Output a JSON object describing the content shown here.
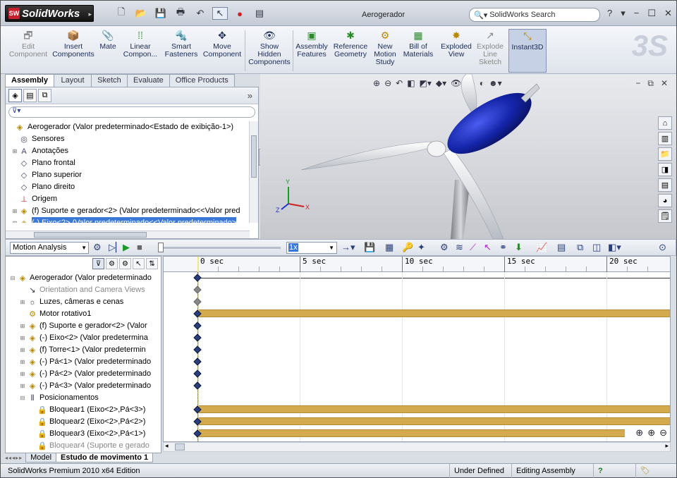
{
  "app": {
    "name": "SolidWorks",
    "doc_title": "Aerogerador",
    "search_placeholder": "SolidWorks Search",
    "help": "?"
  },
  "quick_access": [
    "new-icon",
    "open-icon",
    "save-icon",
    "print-icon",
    "undo-icon",
    "select-icon",
    "rebuild-icon",
    "options-icon"
  ],
  "commands": [
    {
      "id": "edit-component",
      "label": "Edit\nComponent",
      "icon": "🗗",
      "disabled": true
    },
    {
      "id": "insert-components",
      "label": "Insert\nComponents",
      "icon": "📦"
    },
    {
      "id": "mate",
      "label": "Mate",
      "icon": "📎"
    },
    {
      "id": "linear-component",
      "label": "Linear\nCompon...",
      "icon": "⁞⁞"
    },
    {
      "id": "smart-fasteners",
      "label": "Smart\nFasteners",
      "icon": "🔩"
    },
    {
      "id": "move-component",
      "label": "Move\nComponent",
      "icon": "✥"
    },
    {
      "id": "show-hidden",
      "label": "Show\nHidden\nComponents",
      "icon": "👁"
    },
    {
      "id": "assembly-features",
      "label": "Assembly\nFeatures",
      "icon": "▣"
    },
    {
      "id": "reference-geometry",
      "label": "Reference\nGeometry",
      "icon": "✱"
    },
    {
      "id": "new-motion-study",
      "label": "New\nMotion\nStudy",
      "icon": "⚙"
    },
    {
      "id": "bill-of-materials",
      "label": "Bill of\nMaterials",
      "icon": "▦"
    },
    {
      "id": "exploded-view",
      "label": "Exploded\nView",
      "icon": "✸"
    },
    {
      "id": "explode-line-sketch",
      "label": "Explode\nLine\nSketch",
      "icon": "↗",
      "disabled": true
    },
    {
      "id": "instant3d",
      "label": "Instant3D",
      "icon": "⤡",
      "active": true
    }
  ],
  "tabs": [
    "Assembly",
    "Layout",
    "Sketch",
    "Evaluate",
    "Office Products"
  ],
  "feature_tree": [
    {
      "label": "Aerogerador  (Valor predeterminado<Estado de exibição-1>)",
      "icon": "◈",
      "exp": ""
    },
    {
      "label": "Sensores",
      "icon": "◎",
      "exp": "",
      "indent": 1
    },
    {
      "label": "Anotações",
      "icon": "A",
      "exp": "+",
      "indent": 1
    },
    {
      "label": "Plano frontal",
      "icon": "◇",
      "exp": "",
      "indent": 1
    },
    {
      "label": "Plano superior",
      "icon": "◇",
      "exp": "",
      "indent": 1
    },
    {
      "label": "Plano direito",
      "icon": "◇",
      "exp": "",
      "indent": 1
    },
    {
      "label": "Origem",
      "icon": "⊥",
      "exp": "",
      "indent": 1
    },
    {
      "label": "(f) Suporte e gerador<2> (Valor predeterminado<<Valor pred",
      "icon": "◈",
      "exp": "+",
      "indent": 1
    },
    {
      "label": "(-) Eixo<2> (Valor predeterminado<<Valor predeterminado>",
      "icon": "◈",
      "exp": "+",
      "indent": 1,
      "sel": true
    }
  ],
  "motion": {
    "study_type": "Motion Analysis",
    "speed": "1x",
    "ticks": [
      "0 sec",
      "5 sec",
      "10 sec",
      "15 sec",
      "20 sec"
    ],
    "tree": [
      {
        "label": "Aerogerador  (Valor predeterminado",
        "icon": "◈",
        "exp": "−",
        "indent": 0,
        "key": true,
        "bar": false
      },
      {
        "label": "Orientation and Camera Views",
        "icon": "↘",
        "exp": "",
        "indent": 1,
        "dim": true,
        "key": "grey"
      },
      {
        "label": "Luzes, câmeras e cenas",
        "icon": "☼",
        "exp": "+",
        "indent": 1,
        "key": "grey"
      },
      {
        "label": "Motor rotativo1",
        "icon": "⚙",
        "exp": "",
        "indent": 1,
        "key": true,
        "bar": true
      },
      {
        "label": "(f) Suporte e gerador<2> (Valor",
        "icon": "◈",
        "exp": "+",
        "indent": 1,
        "key": true
      },
      {
        "label": "(-) Eixo<2> (Valor predetermina",
        "icon": "◈",
        "exp": "+",
        "indent": 1,
        "key": true
      },
      {
        "label": "(f) Torre<1> (Valor predetermin",
        "icon": "◈",
        "exp": "+",
        "indent": 1,
        "key": true
      },
      {
        "label": "(-) Pá<1> (Valor predeterminado",
        "icon": "◈",
        "exp": "+",
        "indent": 1,
        "key": true
      },
      {
        "label": "(-) Pá<2> (Valor predeterminado",
        "icon": "◈",
        "exp": "+",
        "indent": 1,
        "key": true
      },
      {
        "label": "(-) Pá<3> (Valor predeterminado",
        "icon": "◈",
        "exp": "+",
        "indent": 1,
        "key": true
      },
      {
        "label": "Posicionamentos",
        "icon": "⫴",
        "exp": "−",
        "indent": 1
      },
      {
        "label": "Bloquear1 (Eixo<2>,Pá<3>)",
        "icon": "🔒",
        "exp": "",
        "indent": 2,
        "key": true,
        "bar": true
      },
      {
        "label": "Bloquear2 (Eixo<2>,Pá<2>)",
        "icon": "🔒",
        "exp": "",
        "indent": 2,
        "key": true,
        "bar": true
      },
      {
        "label": "Bloquear3 (Eixo<2>,Pá<1>)",
        "icon": "🔒",
        "exp": "",
        "indent": 2,
        "key": true,
        "bar": true,
        "short": true
      },
      {
        "label": "Bloquear4 (Suporte e gerado",
        "icon": "🔒",
        "exp": "",
        "indent": 2,
        "dim": true
      }
    ]
  },
  "bottom_tabs": [
    "Model",
    "Estudo de movimento 1"
  ],
  "status": {
    "edition": "SolidWorks Premium 2010 x64 Edition",
    "state": "Under Defined",
    "mode": "Editing Assembly",
    "help": "?"
  },
  "colors": {
    "nacelle": "#1424a8",
    "timeline_bar": "#d4aa4f",
    "selection": "#3a77d6",
    "key": "#2a3f7a"
  }
}
